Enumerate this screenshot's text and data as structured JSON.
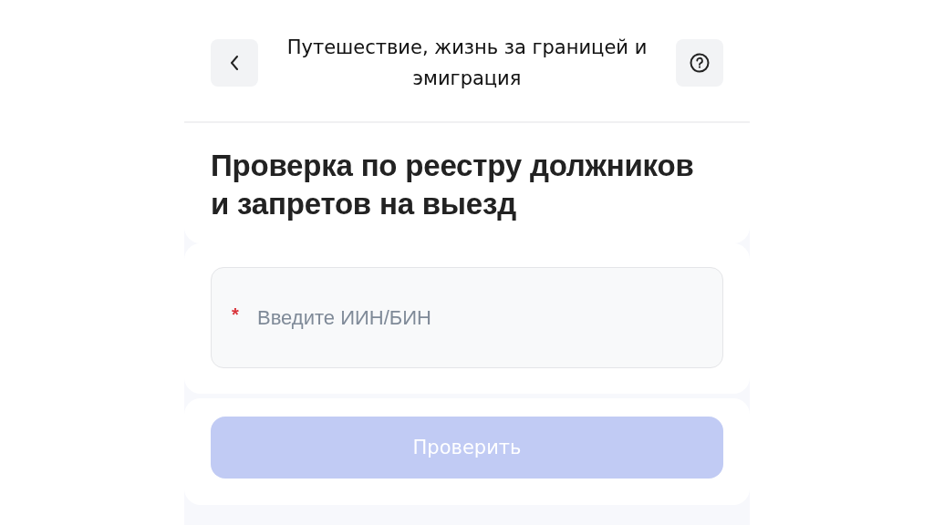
{
  "header": {
    "title": "Путешествие, жизнь за границей и эмиграция"
  },
  "heading": "Проверка по реестру должников и запретов на выезд",
  "field": {
    "placeholder": "Введите ИИН/БИН",
    "required": true,
    "required_mark": "*"
  },
  "button": {
    "label": "Проверить",
    "disabled": true
  }
}
